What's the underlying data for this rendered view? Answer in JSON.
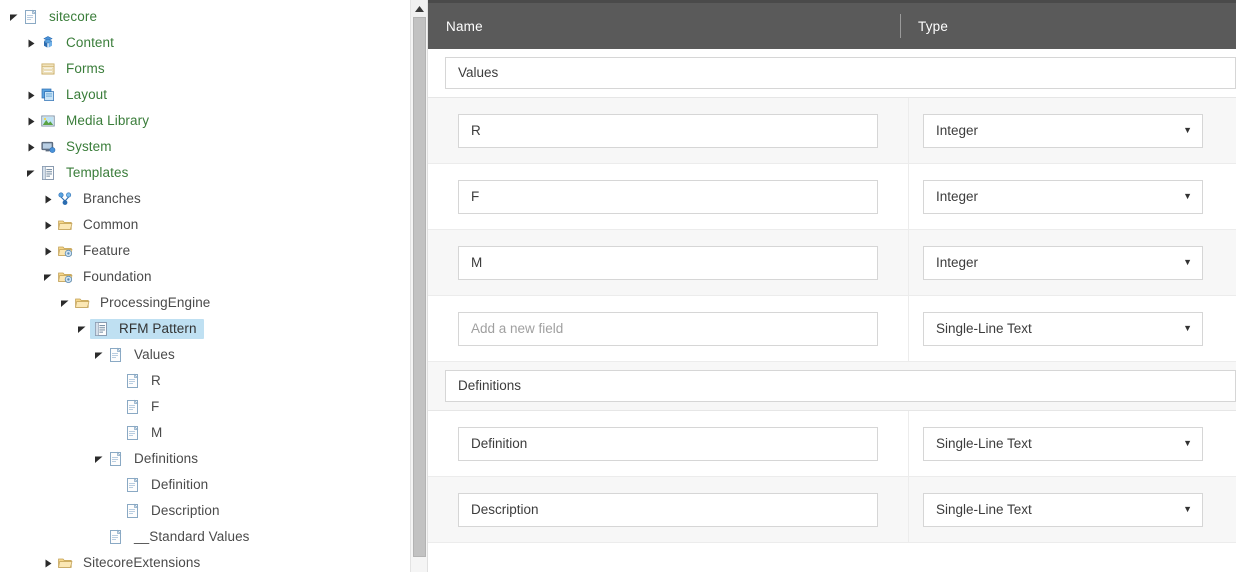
{
  "tree": {
    "items": [
      {
        "label": "sitecore",
        "depth": 0,
        "twisty": "expanded",
        "icon": "item-page-icon",
        "style": "green",
        "selected": false
      },
      {
        "label": "Content",
        "depth": 1,
        "twisty": "collapsed",
        "icon": "content-cubes-icon",
        "style": "green",
        "selected": false
      },
      {
        "label": "Forms",
        "depth": 1,
        "twisty": "none",
        "icon": "forms-icon",
        "style": "green",
        "selected": false
      },
      {
        "label": "Layout",
        "depth": 1,
        "twisty": "collapsed",
        "icon": "layout-icon",
        "style": "green",
        "selected": false
      },
      {
        "label": "Media Library",
        "depth": 1,
        "twisty": "collapsed",
        "icon": "media-library-icon",
        "style": "green",
        "selected": false
      },
      {
        "label": "System",
        "depth": 1,
        "twisty": "collapsed",
        "icon": "system-icon",
        "style": "green",
        "selected": false
      },
      {
        "label": "Templates",
        "depth": 1,
        "twisty": "expanded",
        "icon": "template-icon",
        "style": "green",
        "selected": false
      },
      {
        "label": "Branches",
        "depth": 2,
        "twisty": "collapsed",
        "icon": "branches-icon",
        "style": "plain",
        "selected": false
      },
      {
        "label": "Common",
        "depth": 2,
        "twisty": "collapsed",
        "icon": "folder-icon",
        "style": "plain",
        "selected": false
      },
      {
        "label": "Feature",
        "depth": 2,
        "twisty": "collapsed",
        "icon": "folder-gear-icon",
        "style": "plain",
        "selected": false
      },
      {
        "label": "Foundation",
        "depth": 2,
        "twisty": "expanded",
        "icon": "folder-gear-icon",
        "style": "plain",
        "selected": false
      },
      {
        "label": "ProcessingEngine",
        "depth": 3,
        "twisty": "expanded",
        "icon": "folder-icon",
        "style": "plain",
        "selected": false
      },
      {
        "label": "RFM Pattern",
        "depth": 4,
        "twisty": "expanded",
        "icon": "template-icon",
        "style": "plain",
        "selected": true
      },
      {
        "label": "Values",
        "depth": 5,
        "twisty": "expanded",
        "icon": "item-page-icon",
        "style": "plain",
        "selected": false
      },
      {
        "label": "R",
        "depth": 6,
        "twisty": "none",
        "icon": "item-page-icon",
        "style": "plain",
        "selected": false
      },
      {
        "label": "F",
        "depth": 6,
        "twisty": "none",
        "icon": "item-page-icon",
        "style": "plain",
        "selected": false
      },
      {
        "label": "M",
        "depth": 6,
        "twisty": "none",
        "icon": "item-page-icon",
        "style": "plain",
        "selected": false
      },
      {
        "label": "Definitions",
        "depth": 5,
        "twisty": "expanded",
        "icon": "item-page-icon",
        "style": "plain",
        "selected": false
      },
      {
        "label": "Definition",
        "depth": 6,
        "twisty": "none",
        "icon": "item-page-icon",
        "style": "plain",
        "selected": false
      },
      {
        "label": "Description",
        "depth": 6,
        "twisty": "none",
        "icon": "item-page-icon",
        "style": "plain",
        "selected": false
      },
      {
        "label": "__Standard Values",
        "depth": 5,
        "twisty": "none",
        "icon": "item-page-icon",
        "style": "plain",
        "selected": false
      },
      {
        "label": "SitecoreExtensions",
        "depth": 2,
        "twisty": "collapsed",
        "icon": "folder-icon",
        "style": "plain",
        "selected": false
      }
    ],
    "scrollbar": {
      "up_arrow_icon": "triangle-up-icon"
    }
  },
  "grid": {
    "header": {
      "name_label": "Name",
      "type_label": "Type"
    },
    "sections": [
      {
        "title": "Values",
        "shaded": false,
        "fields": [
          {
            "name": "R",
            "name_is_placeholder": false,
            "type": "Integer",
            "alt": true
          },
          {
            "name": "F",
            "name_is_placeholder": false,
            "type": "Integer",
            "alt": false
          },
          {
            "name": "M",
            "name_is_placeholder": false,
            "type": "Integer",
            "alt": true
          },
          {
            "name": "Add a new field",
            "name_is_placeholder": true,
            "type": "Single-Line Text",
            "alt": false
          }
        ]
      },
      {
        "title": "Definitions",
        "shaded": true,
        "fields": [
          {
            "name": "Definition",
            "name_is_placeholder": false,
            "type": "Single-Line Text",
            "alt": false
          },
          {
            "name": "Description",
            "name_is_placeholder": false,
            "type": "Single-Line Text",
            "alt": true
          }
        ]
      }
    ],
    "dropdown_caret_icon": "chevron-down-icon",
    "colors": {
      "header_bg": "#5a5a5a",
      "header_text": "#ffffff",
      "row_alt_bg": "#f7f7f7",
      "input_border": "#d6d6d6",
      "tree_green": "#3a7d3a",
      "selection_bg": "#bfe0f2"
    }
  }
}
